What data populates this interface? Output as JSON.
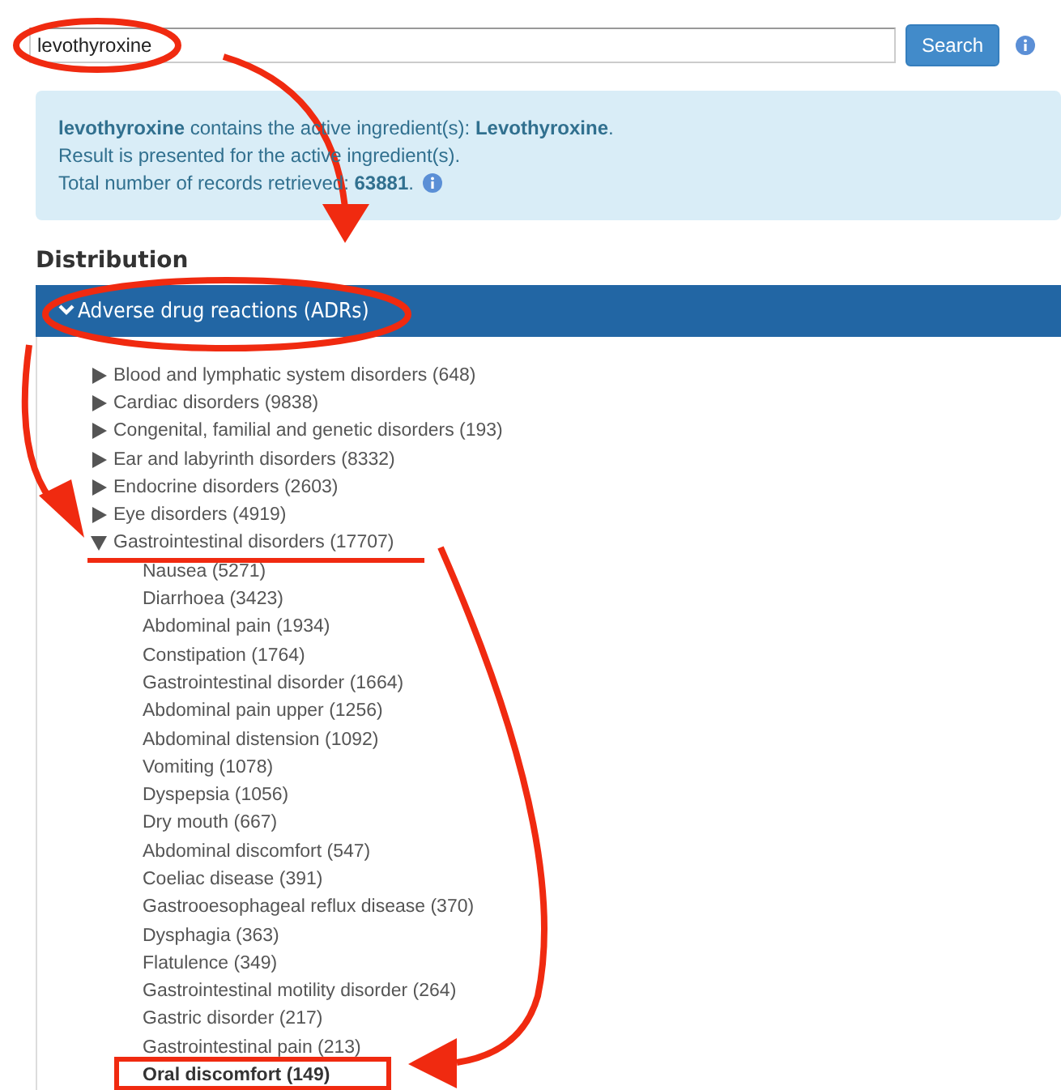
{
  "search": {
    "value": "levothyroxine",
    "button": "Search"
  },
  "alert": {
    "lines": [
      "**levothyroxine** contains the active ingredient(s): **Levothyroxine**.",
      "Result is presented for the active ingredient(s).",
      "Total number of records retrieved: **63881**."
    ]
  },
  "section": {
    "title": "Distribution"
  },
  "panel": {
    "title": "Adverse drug reactions (ADRs)",
    "expanded": true
  },
  "tree": [
    {
      "label": "Blood and lymphatic system disorders (648)",
      "expanded": false
    },
    {
      "label": "Cardiac disorders (9838)",
      "expanded": false
    },
    {
      "label": "Congenital, familial and genetic disorders (193)",
      "expanded": false
    },
    {
      "label": "Ear and labyrinth disorders (8332)",
      "expanded": false
    },
    {
      "label": "Endocrine disorders (2603)",
      "expanded": false
    },
    {
      "label": "Eye disorders (4919)",
      "expanded": false
    },
    {
      "label": "Gastrointestinal disorders (17707)",
      "expanded": true,
      "children": [
        {
          "label": "Nausea (5271)",
          "selected": false
        },
        {
          "label": "Diarrhoea (3423)",
          "selected": false
        },
        {
          "label": "Abdominal pain (1934)",
          "selected": false
        },
        {
          "label": "Constipation (1764)",
          "selected": false
        },
        {
          "label": "Gastrointestinal disorder (1664)",
          "selected": false
        },
        {
          "label": "Abdominal pain upper (1256)",
          "selected": false
        },
        {
          "label": "Abdominal distension (1092)",
          "selected": false
        },
        {
          "label": "Vomiting (1078)",
          "selected": false
        },
        {
          "label": "Dyspepsia (1056)",
          "selected": false
        },
        {
          "label": "Dry mouth (667)",
          "selected": false
        },
        {
          "label": "Abdominal discomfort (547)",
          "selected": false
        },
        {
          "label": "Coeliac disease (391)",
          "selected": false
        },
        {
          "label": "Gastrooesophageal reflux disease (370)",
          "selected": false
        },
        {
          "label": "Dysphagia (363)",
          "selected": false
        },
        {
          "label": "Flatulence (349)",
          "selected": false
        },
        {
          "label": "Gastrointestinal motility disorder (264)",
          "selected": false
        },
        {
          "label": "Gastric disorder (217)",
          "selected": false
        },
        {
          "label": "Gastrointestinal pain (213)",
          "selected": false
        },
        {
          "label": "Oral discomfort (149)",
          "selected": true
        }
      ]
    }
  ]
}
